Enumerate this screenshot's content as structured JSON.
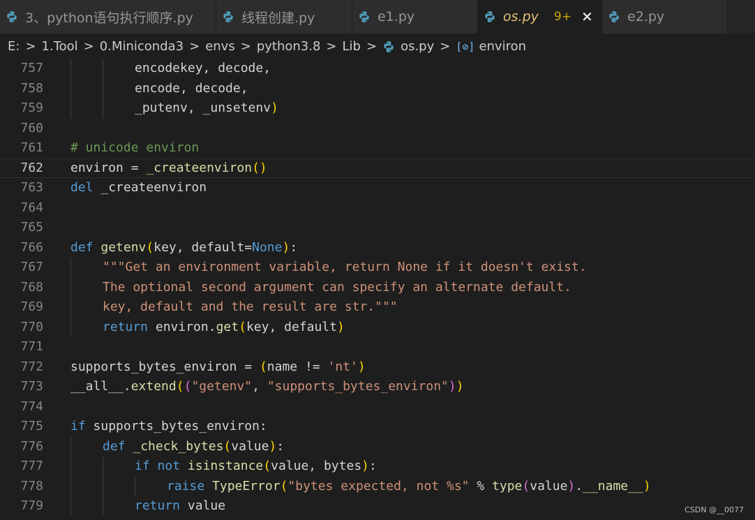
{
  "tabs": [
    {
      "label": "3、python语句执行顺序.py",
      "active": false,
      "width": 310
    },
    {
      "label": "线程创建.py",
      "active": false,
      "width": 195
    },
    {
      "label": "e1.py",
      "active": false,
      "width": 180
    },
    {
      "label": "os.py",
      "active": true,
      "badge": "9+",
      "close": "✕",
      "width": 178
    },
    {
      "label": "e2.py",
      "active": false,
      "width": 180
    }
  ],
  "breadcrumb": {
    "items": [
      "E:",
      "1.Tool",
      "0.Miniconda3",
      "envs",
      "python3.8",
      "Lib",
      "os.py",
      "environ"
    ],
    "separator": ">",
    "symbol_icon": "[⊘]"
  },
  "editor": {
    "current_line": 762,
    "lines": [
      {
        "n": 757,
        "indent": 2,
        "t": [
          [
            "",
            "encodekey, decode,"
          ]
        ]
      },
      {
        "n": 758,
        "indent": 2,
        "t": [
          [
            "",
            "encode, decode,"
          ]
        ]
      },
      {
        "n": 759,
        "indent": 2,
        "t": [
          [
            "",
            "_putenv, _unsetenv"
          ],
          [
            "p1",
            ")"
          ]
        ]
      },
      {
        "n": 760,
        "indent": 0,
        "t": []
      },
      {
        "n": 761,
        "indent": 0,
        "t": [
          [
            "cmt",
            "# unicode environ"
          ]
        ]
      },
      {
        "n": 762,
        "indent": 0,
        "t": [
          [
            "",
            "environ = "
          ],
          [
            "fn",
            "_createenviron"
          ],
          [
            "p1",
            "()"
          ]
        ]
      },
      {
        "n": 763,
        "indent": 0,
        "t": [
          [
            "kw",
            "del"
          ],
          [
            "",
            " _createenviron"
          ]
        ]
      },
      {
        "n": 764,
        "indent": 0,
        "t": []
      },
      {
        "n": 765,
        "indent": 0,
        "t": []
      },
      {
        "n": 766,
        "indent": 0,
        "t": [
          [
            "kw",
            "def"
          ],
          [
            "",
            " "
          ],
          [
            "fn",
            "getenv"
          ],
          [
            "p1",
            "("
          ],
          [
            "",
            "key, default="
          ],
          [
            "kw",
            "None"
          ],
          [
            "p1",
            ")"
          ],
          [
            "",
            ":"
          ]
        ]
      },
      {
        "n": 767,
        "indent": 1,
        "t": [
          [
            "str",
            "\"\"\"Get an environment variable, return None if it doesn't exist."
          ]
        ]
      },
      {
        "n": 768,
        "indent": 1,
        "t": [
          [
            "str",
            "The optional second argument can specify an alternate default."
          ]
        ]
      },
      {
        "n": 769,
        "indent": 1,
        "t": [
          [
            "str",
            "key, default and the result are str.\"\"\""
          ]
        ]
      },
      {
        "n": 770,
        "indent": 1,
        "t": [
          [
            "kw",
            "return"
          ],
          [
            "",
            " environ."
          ],
          [
            "fn",
            "get"
          ],
          [
            "p1",
            "("
          ],
          [
            "",
            "key, default"
          ],
          [
            "p1",
            ")"
          ]
        ]
      },
      {
        "n": 771,
        "indent": 0,
        "t": []
      },
      {
        "n": 772,
        "indent": 0,
        "t": [
          [
            "",
            "supports_bytes_environ = "
          ],
          [
            "p1",
            "("
          ],
          [
            "",
            "name != "
          ],
          [
            "str",
            "'nt'"
          ],
          [
            "p1",
            ")"
          ]
        ]
      },
      {
        "n": 773,
        "indent": 0,
        "t": [
          [
            "",
            "__all__."
          ],
          [
            "fn",
            "extend"
          ],
          [
            "p1",
            "("
          ],
          [
            "p2",
            "("
          ],
          [
            "str",
            "\"getenv\""
          ],
          [
            "",
            ", "
          ],
          [
            "str",
            "\"supports_bytes_environ\""
          ],
          [
            "p2",
            ")"
          ],
          [
            "p1",
            ")"
          ]
        ]
      },
      {
        "n": 774,
        "indent": 0,
        "t": []
      },
      {
        "n": 775,
        "indent": 0,
        "t": [
          [
            "kw",
            "if"
          ],
          [
            "",
            " supports_bytes_environ:"
          ]
        ]
      },
      {
        "n": 776,
        "indent": 1,
        "t": [
          [
            "kw",
            "def"
          ],
          [
            "",
            " "
          ],
          [
            "fn",
            "_check_bytes"
          ],
          [
            "p1",
            "("
          ],
          [
            "",
            "value"
          ],
          [
            "p1",
            ")"
          ],
          [
            "",
            ":"
          ]
        ]
      },
      {
        "n": 777,
        "indent": 2,
        "t": [
          [
            "kw",
            "if"
          ],
          [
            "",
            " "
          ],
          [
            "kw",
            "not"
          ],
          [
            "",
            " "
          ],
          [
            "fn",
            "isinstance"
          ],
          [
            "p1",
            "("
          ],
          [
            "",
            "value, bytes"
          ],
          [
            "p1",
            ")"
          ],
          [
            "",
            ":"
          ]
        ]
      },
      {
        "n": 778,
        "indent": 3,
        "t": [
          [
            "kw",
            "raise"
          ],
          [
            "",
            " "
          ],
          [
            "fn",
            "TypeError"
          ],
          [
            "p1",
            "("
          ],
          [
            "str",
            "\"bytes expected, not %s\""
          ],
          [
            "",
            " % "
          ],
          [
            "fn",
            "type"
          ],
          [
            "p2",
            "("
          ],
          [
            "",
            "value"
          ],
          [
            "p2",
            ")"
          ],
          [
            "",
            "."
          ],
          [
            "fn",
            "__name__"
          ],
          [
            "p1",
            ")"
          ]
        ]
      },
      {
        "n": 779,
        "indent": 2,
        "t": [
          [
            "kw",
            "return"
          ],
          [
            "",
            " value"
          ]
        ]
      }
    ]
  },
  "watermark": "CSDN @__0077"
}
